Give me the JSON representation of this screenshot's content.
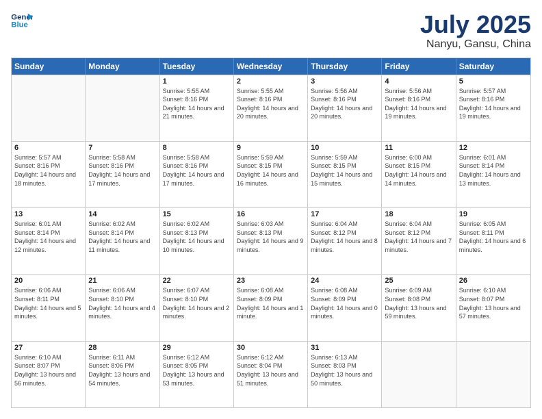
{
  "header": {
    "logo_line1": "General",
    "logo_line2": "Blue",
    "month": "July 2025",
    "location": "Nanyu, Gansu, China"
  },
  "weekdays": [
    "Sunday",
    "Monday",
    "Tuesday",
    "Wednesday",
    "Thursday",
    "Friday",
    "Saturday"
  ],
  "weeks": [
    [
      {
        "day": "",
        "sunrise": "",
        "sunset": "",
        "daylight": ""
      },
      {
        "day": "",
        "sunrise": "",
        "sunset": "",
        "daylight": ""
      },
      {
        "day": "1",
        "sunrise": "Sunrise: 5:55 AM",
        "sunset": "Sunset: 8:16 PM",
        "daylight": "Daylight: 14 hours and 21 minutes."
      },
      {
        "day": "2",
        "sunrise": "Sunrise: 5:55 AM",
        "sunset": "Sunset: 8:16 PM",
        "daylight": "Daylight: 14 hours and 20 minutes."
      },
      {
        "day": "3",
        "sunrise": "Sunrise: 5:56 AM",
        "sunset": "Sunset: 8:16 PM",
        "daylight": "Daylight: 14 hours and 20 minutes."
      },
      {
        "day": "4",
        "sunrise": "Sunrise: 5:56 AM",
        "sunset": "Sunset: 8:16 PM",
        "daylight": "Daylight: 14 hours and 19 minutes."
      },
      {
        "day": "5",
        "sunrise": "Sunrise: 5:57 AM",
        "sunset": "Sunset: 8:16 PM",
        "daylight": "Daylight: 14 hours and 19 minutes."
      }
    ],
    [
      {
        "day": "6",
        "sunrise": "Sunrise: 5:57 AM",
        "sunset": "Sunset: 8:16 PM",
        "daylight": "Daylight: 14 hours and 18 minutes."
      },
      {
        "day": "7",
        "sunrise": "Sunrise: 5:58 AM",
        "sunset": "Sunset: 8:16 PM",
        "daylight": "Daylight: 14 hours and 17 minutes."
      },
      {
        "day": "8",
        "sunrise": "Sunrise: 5:58 AM",
        "sunset": "Sunset: 8:16 PM",
        "daylight": "Daylight: 14 hours and 17 minutes."
      },
      {
        "day": "9",
        "sunrise": "Sunrise: 5:59 AM",
        "sunset": "Sunset: 8:15 PM",
        "daylight": "Daylight: 14 hours and 16 minutes."
      },
      {
        "day": "10",
        "sunrise": "Sunrise: 5:59 AM",
        "sunset": "Sunset: 8:15 PM",
        "daylight": "Daylight: 14 hours and 15 minutes."
      },
      {
        "day": "11",
        "sunrise": "Sunrise: 6:00 AM",
        "sunset": "Sunset: 8:15 PM",
        "daylight": "Daylight: 14 hours and 14 minutes."
      },
      {
        "day": "12",
        "sunrise": "Sunrise: 6:01 AM",
        "sunset": "Sunset: 8:14 PM",
        "daylight": "Daylight: 14 hours and 13 minutes."
      }
    ],
    [
      {
        "day": "13",
        "sunrise": "Sunrise: 6:01 AM",
        "sunset": "Sunset: 8:14 PM",
        "daylight": "Daylight: 14 hours and 12 minutes."
      },
      {
        "day": "14",
        "sunrise": "Sunrise: 6:02 AM",
        "sunset": "Sunset: 8:14 PM",
        "daylight": "Daylight: 14 hours and 11 minutes."
      },
      {
        "day": "15",
        "sunrise": "Sunrise: 6:02 AM",
        "sunset": "Sunset: 8:13 PM",
        "daylight": "Daylight: 14 hours and 10 minutes."
      },
      {
        "day": "16",
        "sunrise": "Sunrise: 6:03 AM",
        "sunset": "Sunset: 8:13 PM",
        "daylight": "Daylight: 14 hours and 9 minutes."
      },
      {
        "day": "17",
        "sunrise": "Sunrise: 6:04 AM",
        "sunset": "Sunset: 8:12 PM",
        "daylight": "Daylight: 14 hours and 8 minutes."
      },
      {
        "day": "18",
        "sunrise": "Sunrise: 6:04 AM",
        "sunset": "Sunset: 8:12 PM",
        "daylight": "Daylight: 14 hours and 7 minutes."
      },
      {
        "day": "19",
        "sunrise": "Sunrise: 6:05 AM",
        "sunset": "Sunset: 8:11 PM",
        "daylight": "Daylight: 14 hours and 6 minutes."
      }
    ],
    [
      {
        "day": "20",
        "sunrise": "Sunrise: 6:06 AM",
        "sunset": "Sunset: 8:11 PM",
        "daylight": "Daylight: 14 hours and 5 minutes."
      },
      {
        "day": "21",
        "sunrise": "Sunrise: 6:06 AM",
        "sunset": "Sunset: 8:10 PM",
        "daylight": "Daylight: 14 hours and 4 minutes."
      },
      {
        "day": "22",
        "sunrise": "Sunrise: 6:07 AM",
        "sunset": "Sunset: 8:10 PM",
        "daylight": "Daylight: 14 hours and 2 minutes."
      },
      {
        "day": "23",
        "sunrise": "Sunrise: 6:08 AM",
        "sunset": "Sunset: 8:09 PM",
        "daylight": "Daylight: 14 hours and 1 minute."
      },
      {
        "day": "24",
        "sunrise": "Sunrise: 6:08 AM",
        "sunset": "Sunset: 8:09 PM",
        "daylight": "Daylight: 14 hours and 0 minutes."
      },
      {
        "day": "25",
        "sunrise": "Sunrise: 6:09 AM",
        "sunset": "Sunset: 8:08 PM",
        "daylight": "Daylight: 13 hours and 59 minutes."
      },
      {
        "day": "26",
        "sunrise": "Sunrise: 6:10 AM",
        "sunset": "Sunset: 8:07 PM",
        "daylight": "Daylight: 13 hours and 57 minutes."
      }
    ],
    [
      {
        "day": "27",
        "sunrise": "Sunrise: 6:10 AM",
        "sunset": "Sunset: 8:07 PM",
        "daylight": "Daylight: 13 hours and 56 minutes."
      },
      {
        "day": "28",
        "sunrise": "Sunrise: 6:11 AM",
        "sunset": "Sunset: 8:06 PM",
        "daylight": "Daylight: 13 hours and 54 minutes."
      },
      {
        "day": "29",
        "sunrise": "Sunrise: 6:12 AM",
        "sunset": "Sunset: 8:05 PM",
        "daylight": "Daylight: 13 hours and 53 minutes."
      },
      {
        "day": "30",
        "sunrise": "Sunrise: 6:12 AM",
        "sunset": "Sunset: 8:04 PM",
        "daylight": "Daylight: 13 hours and 51 minutes."
      },
      {
        "day": "31",
        "sunrise": "Sunrise: 6:13 AM",
        "sunset": "Sunset: 8:03 PM",
        "daylight": "Daylight: 13 hours and 50 minutes."
      },
      {
        "day": "",
        "sunrise": "",
        "sunset": "",
        "daylight": ""
      },
      {
        "day": "",
        "sunrise": "",
        "sunset": "",
        "daylight": ""
      }
    ]
  ]
}
